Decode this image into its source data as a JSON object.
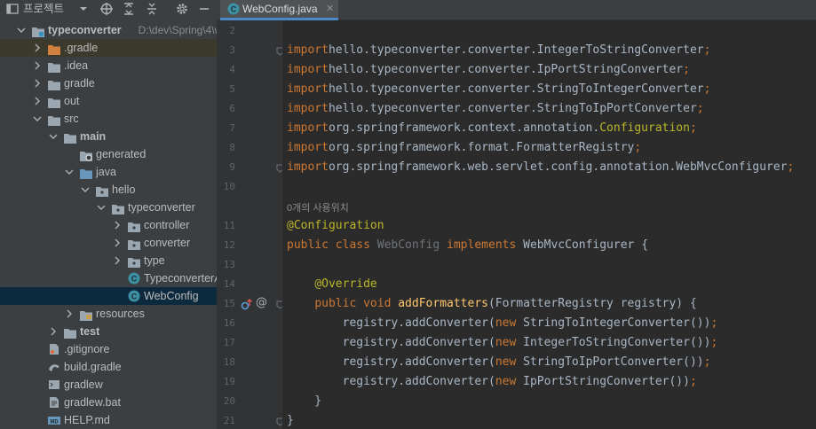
{
  "project_panel": {
    "title": "프로젝트",
    "tree": [
      {
        "label": "typeconverter",
        "bold": true,
        "path": "D:\\dev\\Spring\\4\\w",
        "depth": 0,
        "arrow": "down",
        "icon": "folder-module",
        "hl": "none"
      },
      {
        "label": ".gradle",
        "depth": 1,
        "arrow": "right",
        "icon": "folder-orange",
        "hl": "yellow"
      },
      {
        "label": ".idea",
        "depth": 1,
        "arrow": "right",
        "icon": "folder",
        "hl": "none"
      },
      {
        "label": "gradle",
        "depth": 1,
        "arrow": "right",
        "icon": "folder",
        "hl": "none"
      },
      {
        "label": "out",
        "depth": 1,
        "arrow": "right",
        "icon": "folder",
        "hl": "none"
      },
      {
        "label": "src",
        "depth": 1,
        "arrow": "down",
        "icon": "folder",
        "hl": "none"
      },
      {
        "label": "main",
        "bold": true,
        "depth": 2,
        "arrow": "down",
        "icon": "folder",
        "hl": "none"
      },
      {
        "label": "generated",
        "depth": 3,
        "arrow": "none",
        "icon": "folder-generated",
        "hl": "none"
      },
      {
        "label": "java",
        "depth": 3,
        "arrow": "down",
        "icon": "folder-source",
        "hl": "none"
      },
      {
        "label": "hello",
        "depth": 4,
        "arrow": "down",
        "icon": "package",
        "hl": "none"
      },
      {
        "label": "typeconverter",
        "depth": 5,
        "arrow": "down",
        "icon": "package",
        "hl": "none"
      },
      {
        "label": "controller",
        "depth": 6,
        "arrow": "right",
        "icon": "package",
        "hl": "none"
      },
      {
        "label": "converter",
        "depth": 6,
        "arrow": "right",
        "icon": "package",
        "hl": "none"
      },
      {
        "label": "type",
        "depth": 6,
        "arrow": "right",
        "icon": "package",
        "hl": "none"
      },
      {
        "label": "TypeconverterApp",
        "depth": 6,
        "arrow": "none",
        "icon": "class",
        "hl": "none"
      },
      {
        "label": "WebConfig",
        "depth": 6,
        "arrow": "none",
        "icon": "class",
        "hl": "selected"
      },
      {
        "label": "resources",
        "depth": 3,
        "arrow": "right",
        "icon": "folder-resources",
        "hl": "none"
      },
      {
        "label": "test",
        "bold": true,
        "depth": 2,
        "arrow": "right",
        "icon": "folder",
        "hl": "none"
      },
      {
        "label": ".gitignore",
        "depth": 1,
        "arrow": "none",
        "icon": "file-git",
        "hl": "none"
      },
      {
        "label": "build.gradle",
        "depth": 1,
        "arrow": "none",
        "icon": "file-gradle",
        "hl": "none"
      },
      {
        "label": "gradlew",
        "depth": 1,
        "arrow": "none",
        "icon": "file-shell",
        "hl": "none"
      },
      {
        "label": "gradlew.bat",
        "depth": 1,
        "arrow": "none",
        "icon": "file-text",
        "hl": "none"
      },
      {
        "label": "HELP.md",
        "depth": 1,
        "arrow": "none",
        "icon": "file-markdown",
        "hl": "none"
      }
    ]
  },
  "editor": {
    "tab_label": "WebConfig.java",
    "usage_hint": "0개의 사용위치",
    "lines": [
      {
        "n": "2",
        "tokens": []
      },
      {
        "n": "3",
        "fold": true,
        "tokens": [
          [
            "kw",
            "import"
          ],
          [
            "",
            "hello.typeconverter.converter.IntegerToStringConverter"
          ],
          [
            "kw",
            ";"
          ]
        ]
      },
      {
        "n": "4",
        "tokens": [
          [
            "kw",
            "import"
          ],
          [
            "",
            "hello.typeconverter.converter.IpPortStringConverter"
          ],
          [
            "kw",
            ";"
          ]
        ]
      },
      {
        "n": "5",
        "tokens": [
          [
            "kw",
            "import"
          ],
          [
            "",
            "hello.typeconverter.converter.StringToIntegerConverter"
          ],
          [
            "kw",
            ";"
          ]
        ]
      },
      {
        "n": "6",
        "tokens": [
          [
            "kw",
            "import"
          ],
          [
            "",
            "hello.typeconverter.converter.StringToIpPortConverter"
          ],
          [
            "kw",
            ";"
          ]
        ]
      },
      {
        "n": "7",
        "tokens": [
          [
            "kw",
            "import"
          ],
          [
            "",
            "org.springframework.context.annotation."
          ],
          [
            "ann",
            "Configuration"
          ],
          [
            "kw",
            ";"
          ]
        ]
      },
      {
        "n": "8",
        "tokens": [
          [
            "kw",
            "import"
          ],
          [
            "",
            "org.springframework.format.FormatterRegistry"
          ],
          [
            "kw",
            ";"
          ]
        ]
      },
      {
        "n": "9",
        "fold": true,
        "tokens": [
          [
            "kw",
            "import"
          ],
          [
            "",
            "org.springframework.web.servlet.config.annotation.WebMvcConfigurer"
          ],
          [
            "kw",
            ";"
          ]
        ]
      },
      {
        "n": "10",
        "tokens": []
      },
      {
        "n": "11",
        "tokens": [
          [
            "ann",
            "@Configuration"
          ]
        ]
      },
      {
        "n": "12",
        "tokens": [
          [
            "kw",
            "public class"
          ],
          [
            "",
            " "
          ],
          [
            "dim",
            "WebConfig"
          ],
          [
            "",
            " "
          ],
          [
            "kw",
            "implements"
          ],
          [
            "",
            " WebMvcConfigurer {"
          ]
        ]
      },
      {
        "n": "13",
        "tokens": []
      },
      {
        "n": "14",
        "tokens": [
          [
            "",
            "    "
          ],
          [
            "ann",
            "@Override"
          ]
        ]
      },
      {
        "n": "15",
        "fold": true,
        "gutter_icons": true,
        "tokens": [
          [
            "",
            "    "
          ],
          [
            "kw",
            "public void"
          ],
          [
            "",
            " "
          ],
          [
            "fn",
            "addFormatters"
          ],
          [
            "",
            "(FormatterRegistry registry) {"
          ]
        ]
      },
      {
        "n": "16",
        "tokens": [
          [
            "",
            "        registry.addConverter("
          ],
          [
            "kw",
            "new"
          ],
          [
            "",
            " StringToIntegerConverter())"
          ],
          [
            "kw",
            ";"
          ]
        ]
      },
      {
        "n": "17",
        "tokens": [
          [
            "",
            "        registry.addConverter("
          ],
          [
            "kw",
            "new"
          ],
          [
            "",
            " IntegerToStringConverter())"
          ],
          [
            "kw",
            ";"
          ]
        ]
      },
      {
        "n": "18",
        "tokens": [
          [
            "",
            "        registry.addConverter("
          ],
          [
            "kw",
            "new"
          ],
          [
            "",
            " StringToIpPortConverter())"
          ],
          [
            "kw",
            ";"
          ]
        ]
      },
      {
        "n": "19",
        "tokens": [
          [
            "",
            "        registry.addConverter("
          ],
          [
            "kw",
            "new"
          ],
          [
            "",
            " IpPortStringConverter())"
          ],
          [
            "kw",
            ";"
          ]
        ]
      },
      {
        "n": "20",
        "tokens": [
          [
            "",
            "    }"
          ]
        ]
      },
      {
        "n": "21",
        "fold": true,
        "tokens": [
          [
            "",
            "}"
          ]
        ]
      }
    ]
  },
  "colors": {
    "panel_bg": "#3c3f41",
    "editor_bg": "#2b2b2b",
    "gutter_bg": "#313335",
    "selection": "#0d293e",
    "keyword": "#cc7832",
    "annotation": "#bbb529",
    "function": "#ffc66d"
  }
}
